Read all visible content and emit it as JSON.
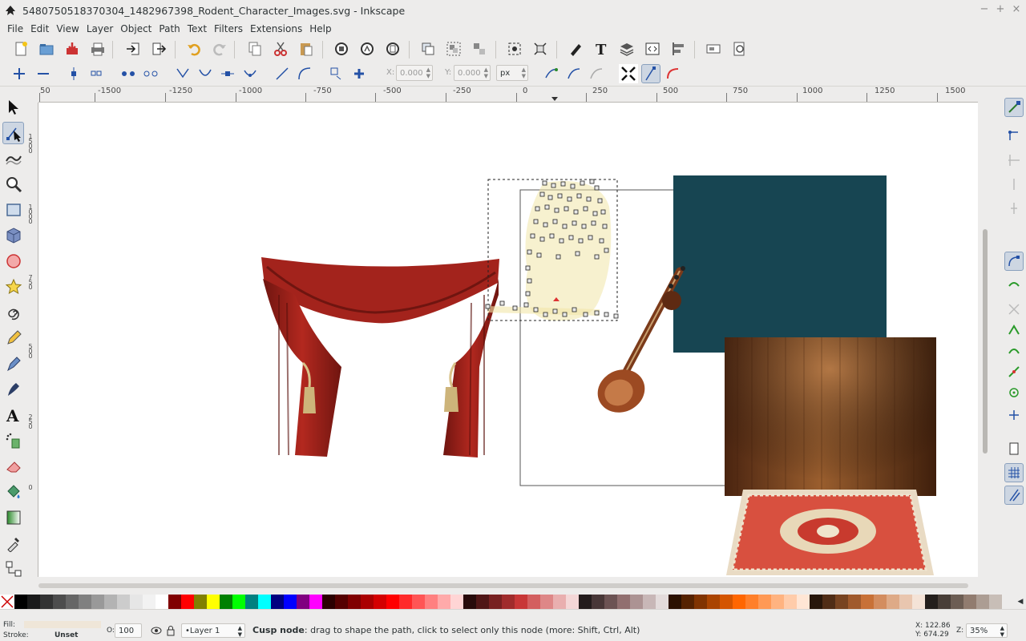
{
  "window": {
    "title": "5480750518370304_1482967398_Rodent_Character_Images.svg - Inkscape",
    "minimize": "−",
    "maximize": "+",
    "close": "×"
  },
  "menu": [
    "File",
    "Edit",
    "View",
    "Layer",
    "Object",
    "Path",
    "Text",
    "Filters",
    "Extensions",
    "Help"
  ],
  "ctrl": {
    "x_label": "X:",
    "x_value": "0.000",
    "y_label": "Y:",
    "y_value": "0.000",
    "unit": "px"
  },
  "ruler_top": [
    "50",
    "-1500",
    "-1250",
    "-1000",
    "-750",
    "-500",
    "-250",
    "0",
    "250",
    "500",
    "750",
    "1000",
    "1250",
    "1500"
  ],
  "ruler_left": [
    "1 5 0 0",
    "1 0 0 0",
    "7 5 0",
    "5 0 0",
    "2 5 0",
    "0"
  ],
  "palette": [
    "#000000",
    "#1a1a1a",
    "#333333",
    "#4d4d4d",
    "#666666",
    "#808080",
    "#999999",
    "#b3b3b3",
    "#cccccc",
    "#e6e6e6",
    "#f2f2f2",
    "#ffffff",
    "#800000",
    "#ff0000",
    "#808000",
    "#ffff00",
    "#008000",
    "#00ff00",
    "#008080",
    "#00ffff",
    "#000080",
    "#0000ff",
    "#800080",
    "#ff00ff",
    "#2b0000",
    "#550000",
    "#800000",
    "#aa0000",
    "#d40000",
    "#ff0000",
    "#ff2a2a",
    "#ff5555",
    "#ff8080",
    "#ffaaaa",
    "#ffd5d5",
    "#280b0b",
    "#501616",
    "#782121",
    "#a02c2c",
    "#c83737",
    "#d35f5f",
    "#de8787",
    "#e9afaf",
    "#f4d7d7",
    "#241c1c",
    "#483737",
    "#6c5353",
    "#916f6f",
    "#ac9393",
    "#c8b7b7",
    "#e3dbdb",
    "#2b1100",
    "#552200",
    "#803300",
    "#aa4400",
    "#d45500",
    "#ff6600",
    "#ff7f2a",
    "#ff9955",
    "#ffb380",
    "#ffccaa",
    "#ffe6d5",
    "#28170b",
    "#502d16",
    "#784421",
    "#a05a2c",
    "#c87137",
    "#d38d5f",
    "#deaa87",
    "#e9c6af",
    "#f4e3d7",
    "#241f1c",
    "#483e37",
    "#6c5d53",
    "#917c6f",
    "#ac9d93",
    "#c8beb7"
  ],
  "status": {
    "fill_label": "Fill:",
    "stroke_label": "Stroke:",
    "stroke_value": "Unset",
    "opacity_label": "O:",
    "opacity_value": "100",
    "layer": "•Layer 1",
    "message_bold": "Cusp node",
    "message_rest": ": drag to shape the path, click to select only this node (more: Shift, Ctrl, Alt)",
    "x_coord": "X: 122.86",
    "y_coord": "Y: 674.29",
    "zoom_label": "Z:",
    "zoom_value": "35%"
  },
  "colors": {
    "teal_rect": "#174552",
    "wood": "#6b3a17",
    "curtain": "#a3231c",
    "rug": "#d8503f"
  }
}
